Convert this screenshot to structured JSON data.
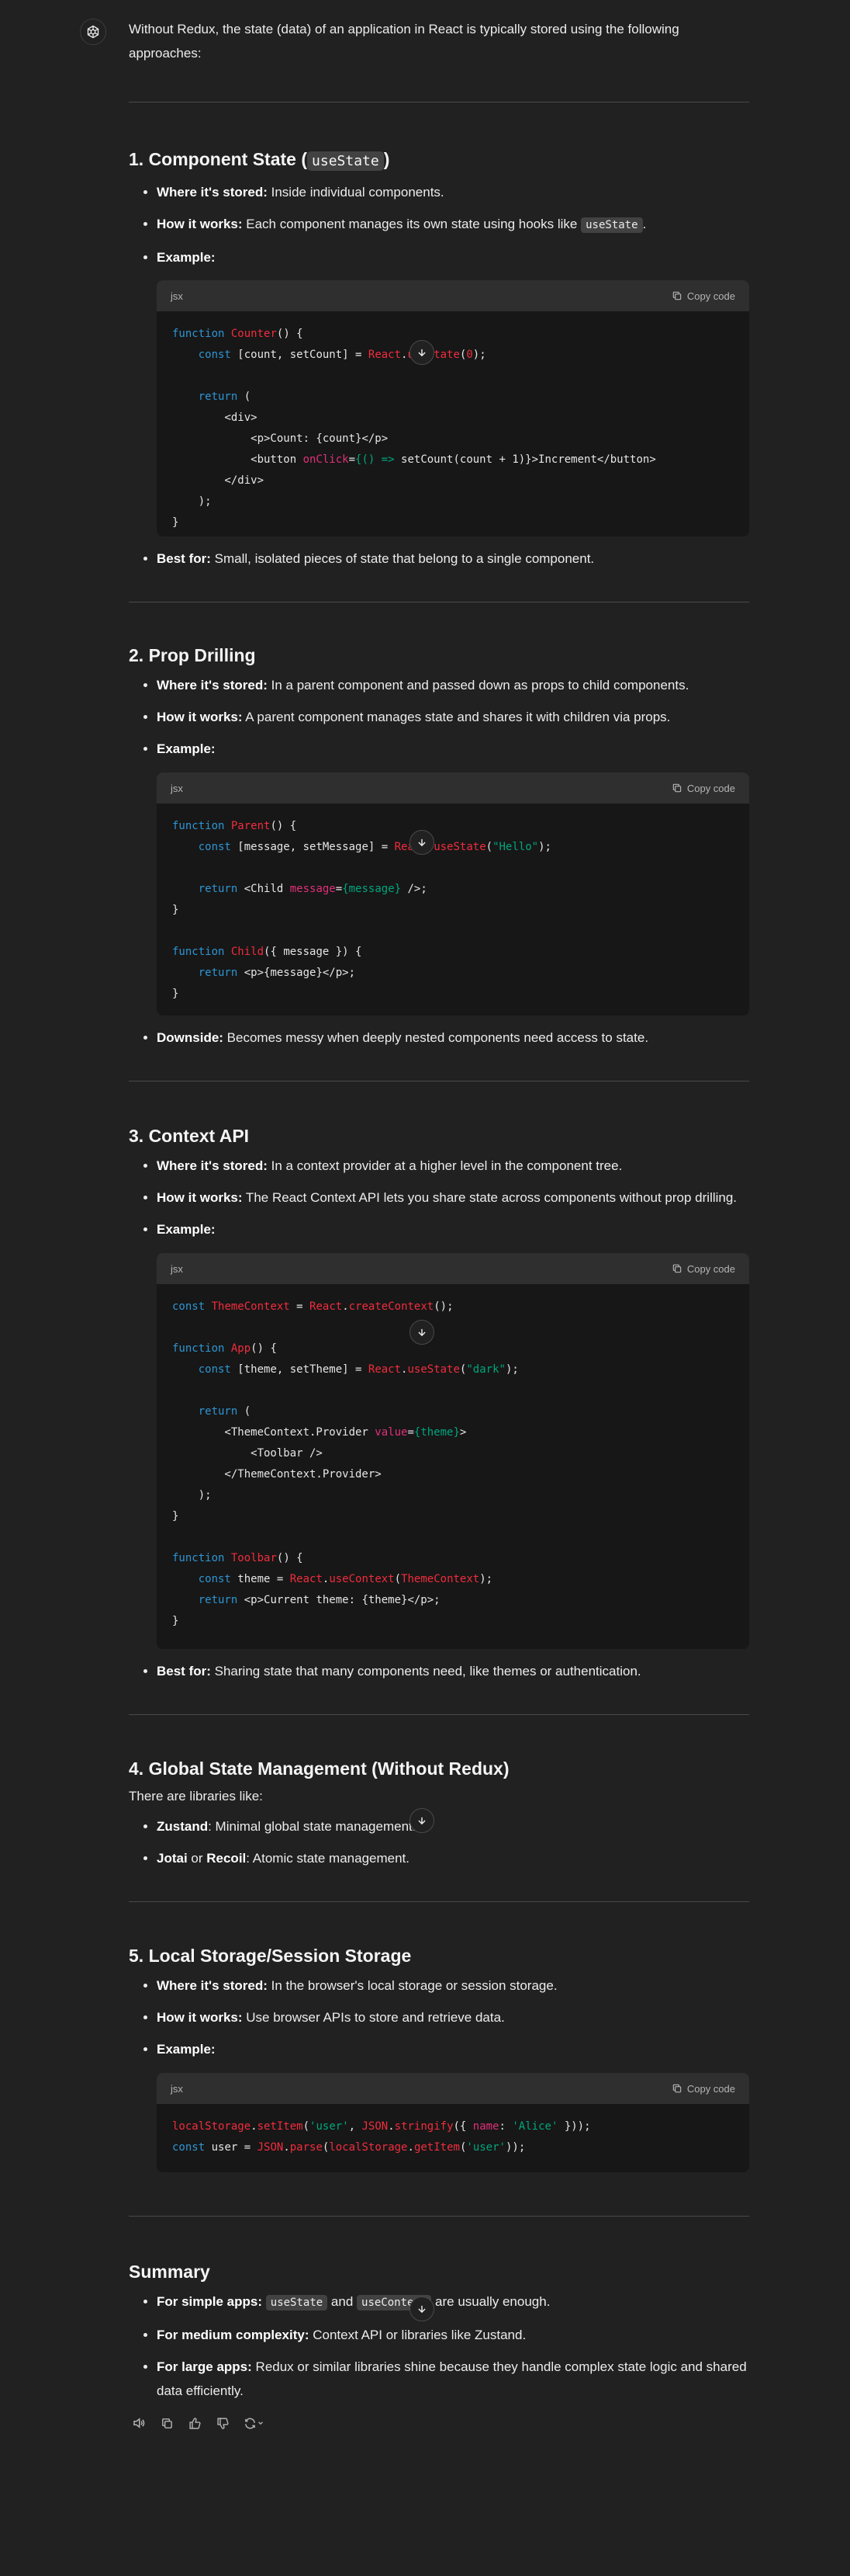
{
  "intro": "Without Redux, the state (data) of an application in React is typically stored using the following approaches:",
  "s1": {
    "heading_prefix": "1. Component State (",
    "heading_code": "useState",
    "heading_suffix": ")",
    "where_label": "Where it's stored:",
    "where_text": " Inside individual components.",
    "how_label": "How it works:",
    "how_text": " Each component manages its own state using hooks like ",
    "how_code": "useState",
    "how_end": ".",
    "example_label": "Example:",
    "code_lang": "jsx",
    "copy_label": "Copy code",
    "best_label": "Best for:",
    "best_text": " Small, isolated pieces of state that belong to a single component."
  },
  "s2": {
    "heading": "2. Prop Drilling",
    "where_label": "Where it's stored:",
    "where_text": " In a parent component and passed down as props to child components.",
    "how_label": "How it works:",
    "how_text": " A parent component manages state and shares it with children via props.",
    "example_label": "Example:",
    "code_lang": "jsx",
    "copy_label": "Copy code",
    "down_label": "Downside:",
    "down_text": " Becomes messy when deeply nested components need access to state."
  },
  "s3": {
    "heading": "3. Context API",
    "where_label": "Where it's stored:",
    "where_text": " In a context provider at a higher level in the component tree.",
    "how_label": "How it works:",
    "how_text": " The React Context API lets you share state across components without prop drilling.",
    "example_label": "Example:",
    "code_lang": "jsx",
    "copy_label": "Copy code",
    "best_label": "Best for:",
    "best_text": " Sharing state that many components need, like themes or authentication."
  },
  "s4": {
    "heading": "4. Global State Management (Without Redux)",
    "intro": "There are libraries like:",
    "zustand_label": "Zustand",
    "zustand_text": ": Minimal global state management.",
    "jotai_label": "Jotai",
    "jotai_or": " or ",
    "recoil_label": "Recoil",
    "recoil_text": ": Atomic state management."
  },
  "s5": {
    "heading": "5. Local Storage/Session Storage",
    "where_label": "Where it's stored:",
    "where_text": " In the browser's local storage or session storage.",
    "how_label": "How it works:",
    "how_text": " Use browser APIs to store and retrieve data.",
    "example_label": "Example:",
    "code_lang": "jsx",
    "copy_label": "Copy code"
  },
  "summary": {
    "heading": "Summary",
    "simple_label": "For simple apps:",
    "simple_code1": "useState",
    "simple_and": " and ",
    "simple_code2": "useContext",
    "simple_text": " are usually enough.",
    "medium_label": "For medium complexity:",
    "medium_text": " Context API or libraries like Zustand.",
    "large_label": "For large apps:",
    "large_text": " Redux or similar libraries shine because they handle complex state logic and shared data efficiently."
  },
  "icons": {
    "avatar": "openai-logo-icon",
    "copy": "copy-icon",
    "scroll": "arrow-down-icon",
    "read_aloud": "speaker-icon",
    "copy_message": "copy-icon",
    "like": "thumbs-up-icon",
    "dislike": "thumbs-down-icon",
    "regenerate": "refresh-icon"
  },
  "colors": {
    "background": "#212121",
    "code_bg": "#171717",
    "code_header": "#2f2f2f",
    "keyword": "#2e95d3",
    "function": "#f22c3d",
    "string": "#00a67d",
    "attribute": "#df3079"
  }
}
